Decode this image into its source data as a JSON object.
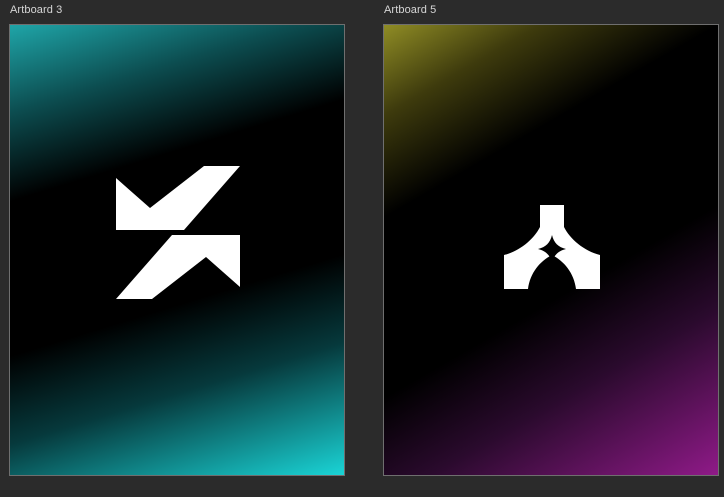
{
  "artboards": [
    {
      "label": "Artboard 3",
      "gradient_colors": [
        "#1fa5a8",
        "#000000",
        "#1ad4d6"
      ],
      "logo": "zigzag-arrows-logo-icon"
    },
    {
      "label": "Artboard 5",
      "gradient_colors": [
        "#8f8c25",
        "#000000",
        "#8f1a88"
      ],
      "logo": "arch-star-logo-icon"
    }
  ],
  "colors": {
    "canvas_background": "#2b2b2b",
    "label_text": "#d6d6d6",
    "artboard_border": "#6f6f6f",
    "logo_fill": "#ffffff"
  }
}
